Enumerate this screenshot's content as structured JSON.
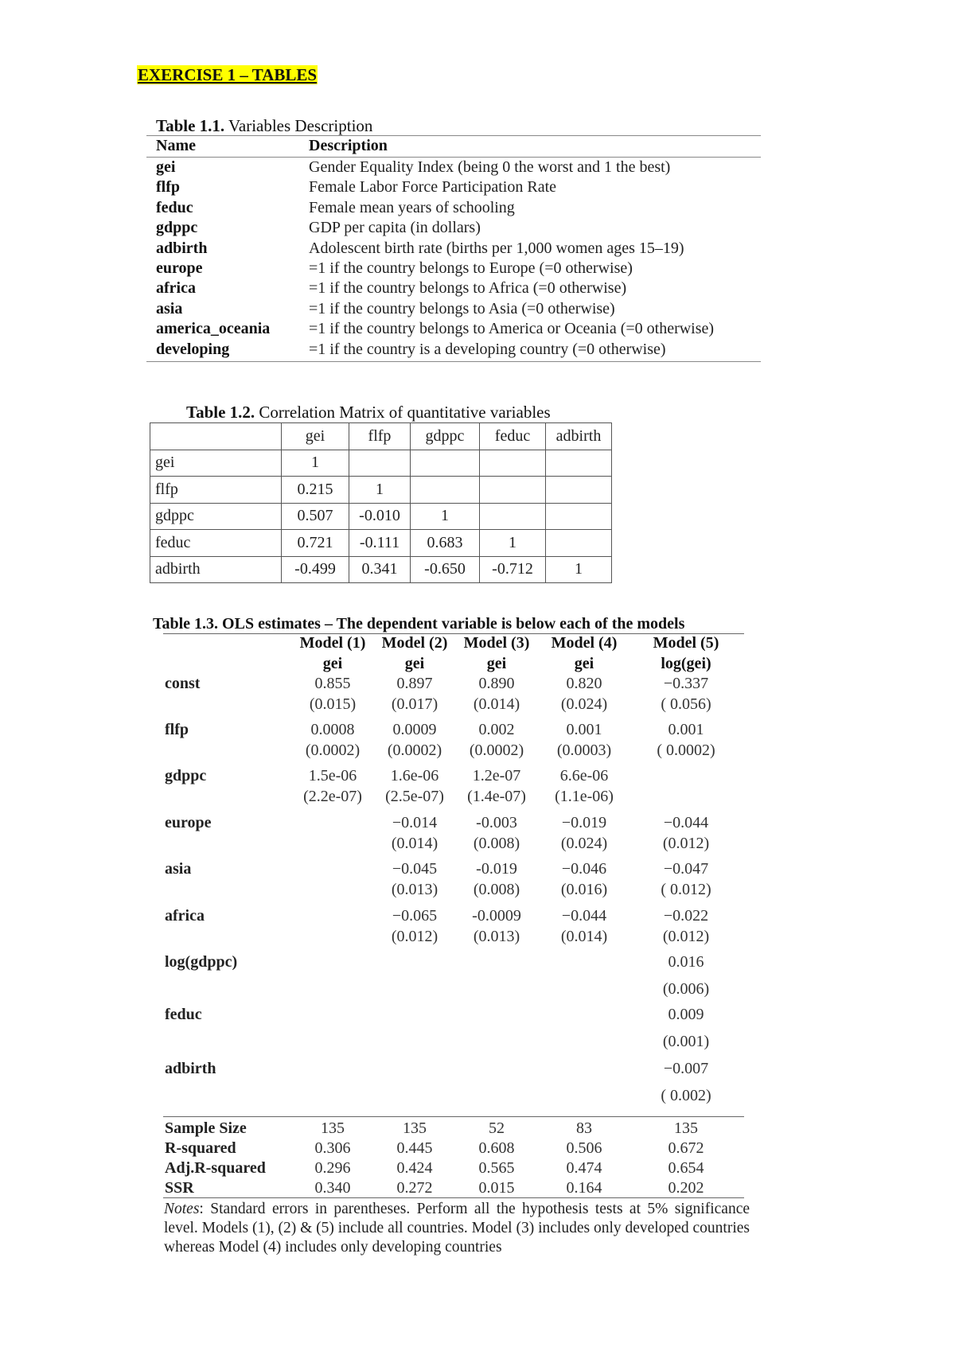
{
  "heading": "EXERCISE 1 – TABLES",
  "table_1_1": {
    "caption_label": "Table 1.1.",
    "caption_text": " Variables Description",
    "headers": [
      "Name",
      "Description"
    ],
    "rows": [
      {
        "name": "gei",
        "desc": "Gender Equality Index (being 0 the worst and 1 the best)"
      },
      {
        "name": "flfp",
        "desc": "Female Labor Force Participation Rate"
      },
      {
        "name": "feduc",
        "desc": "Female mean years of schooling"
      },
      {
        "name": "gdppc",
        "desc": "GDP per capita (in dollars)"
      },
      {
        "name": "adbirth",
        "desc": "Adolescent birth rate (births per 1,000 women ages 15–19)"
      },
      {
        "name": "europe",
        "desc": "=1 if the country belongs to Europe (=0 otherwise)"
      },
      {
        "name": "africa",
        "desc": "=1 if the country belongs to Africa (=0 otherwise)"
      },
      {
        "name": "asia",
        "desc": "=1 if the country belongs to Asia (=0 otherwise)"
      },
      {
        "name": "america_oceania",
        "desc": "=1 if the country belongs to America or Oceania (=0 otherwise)"
      },
      {
        "name": "developing",
        "desc": "=1 if the country is a developing country (=0 otherwise)"
      }
    ]
  },
  "table_1_2": {
    "caption_label": "Table 1.2.",
    "caption_text": " Correlation Matrix of quantitative variables",
    "columns": [
      "",
      "gei",
      "flfp",
      "gdppc",
      "feduc",
      "adbirth"
    ],
    "rows": [
      [
        "gei",
        "1",
        "",
        "",
        "",
        ""
      ],
      [
        "flfp",
        "0.215",
        "1",
        "",
        "",
        ""
      ],
      [
        "gdppc",
        "0.507",
        "-0.010",
        "1",
        "",
        ""
      ],
      [
        "feduc",
        "0.721",
        "-0.111",
        "0.683",
        "1",
        ""
      ],
      [
        "adbirth",
        "-0.499",
        "0.341",
        "-0.650",
        "-0.712",
        "1"
      ]
    ]
  },
  "table_1_3": {
    "caption": "Table 1.3. OLS estimates – The dependent variable is below each of the models",
    "models": [
      "Model (1)",
      "Model (2)",
      "Model (3)",
      "Model (4)",
      "Model (5)"
    ],
    "dependent": [
      "gei",
      "gei",
      "gei",
      "gei",
      "log(gei)"
    ],
    "coefficients": [
      {
        "label": "const",
        "est": [
          "0.855",
          "0.897",
          "0.890",
          "0.820",
          "−0.337"
        ],
        "se": [
          "(0.015)",
          "(0.017)",
          "(0.014)",
          "(0.024)",
          "( 0.056)"
        ]
      },
      {
        "label": "flfp",
        "est": [
          "0.0008",
          "0.0009",
          "0.002",
          "0.001",
          "0.001"
        ],
        "se": [
          "(0.0002)",
          "(0.0002)",
          "(0.0002)",
          "(0.0003)",
          "( 0.0002)"
        ]
      },
      {
        "label": "gdppc",
        "est": [
          "1.5e-06",
          "1.6e-06",
          "1.2e-07",
          "6.6e-06",
          ""
        ],
        "se": [
          "(2.2e-07)",
          "(2.5e-07)",
          "(1.4e-07)",
          "(1.1e-06)",
          ""
        ]
      },
      {
        "label": "europe",
        "est": [
          "",
          "−0.014",
          "-0.003",
          "−0.019",
          "−0.044"
        ],
        "se": [
          "",
          "(0.014)",
          "(0.008)",
          "(0.024)",
          "(0.012)"
        ]
      },
      {
        "label": "asia",
        "est": [
          "",
          "−0.045",
          "-0.019",
          "−0.046",
          "−0.047"
        ],
        "se": [
          "",
          "(0.013)",
          "(0.008)",
          "(0.016)",
          "( 0.012)"
        ]
      },
      {
        "label": "africa",
        "est": [
          "",
          "−0.065",
          "-0.0009",
          "−0.044",
          "−0.022"
        ],
        "se": [
          "",
          "(0.012)",
          "(0.013)",
          "(0.014)",
          "(0.012)"
        ]
      },
      {
        "label": "log(gdppc)",
        "est": [
          "",
          "",
          "",
          "",
          "0.016"
        ],
        "se": [
          "",
          "",
          "",
          "",
          "(0.006)"
        ]
      },
      {
        "label": "feduc",
        "est": [
          "",
          "",
          "",
          "",
          "0.009"
        ],
        "se": [
          "",
          "",
          "",
          "",
          "(0.001)"
        ]
      },
      {
        "label": "adbirth",
        "est": [
          "",
          "",
          "",
          "",
          "−0.007"
        ],
        "se": [
          "",
          "",
          "",
          "",
          "( 0.002)"
        ]
      }
    ],
    "stats": [
      {
        "label": "Sample Size",
        "values": [
          "135",
          "135",
          "52",
          "83",
          "135"
        ]
      },
      {
        "label": "R-squared",
        "values": [
          "0.306",
          "0.445",
          "0.608",
          "0.506",
          "0.672"
        ]
      },
      {
        "label": "Adj.R-squared",
        "values": [
          "0.296",
          "0.424",
          "0.565",
          "0.474",
          "0.654"
        ]
      },
      {
        "label": "SSR",
        "values": [
          "0.340",
          "0.272",
          "0.015",
          "0.164",
          "0.202"
        ]
      }
    ],
    "notes_label": "Notes",
    "notes_text": ": Standard errors in parentheses. Perform all the hypothesis tests at 5% significance level. Models (1), (2) & (5) include all countries. Model (3) includes only developed countries whereas Model (4) includes only developing countries"
  }
}
